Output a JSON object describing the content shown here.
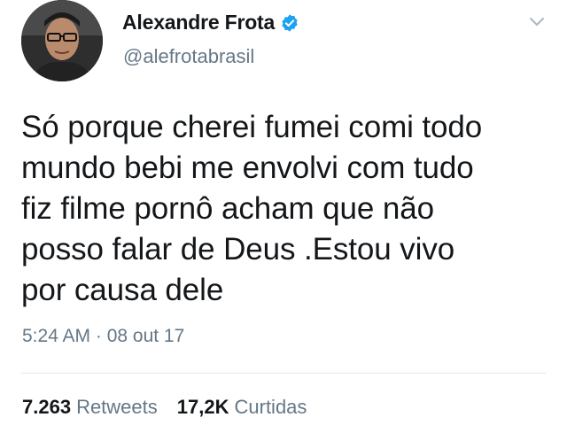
{
  "user": {
    "display_name": "Alexandre Frota",
    "handle": "@alefrotabrasil",
    "verified": true,
    "avatar": "profile-photo"
  },
  "tweet": {
    "text": "Só porque cherei fumei comi todo\nmundo bebi me envolvi com tudo\nfiz filme pornô acham que não\nposso falar de Deus .Estou vivo\npor causa dele",
    "timestamp": "5:24 AM · 08 out 17"
  },
  "stats": {
    "retweets_count": "7.263",
    "retweets_label": "Retweets",
    "likes_count": "17,2K",
    "likes_label": "Curtidas"
  },
  "icons": {
    "verified": "verified-badge-icon",
    "menu": "chevron-down-icon"
  },
  "colors": {
    "text_primary": "#14171a",
    "text_secondary": "#657786",
    "verified_blue": "#1da1f2",
    "divider": "#e1e8ed"
  }
}
